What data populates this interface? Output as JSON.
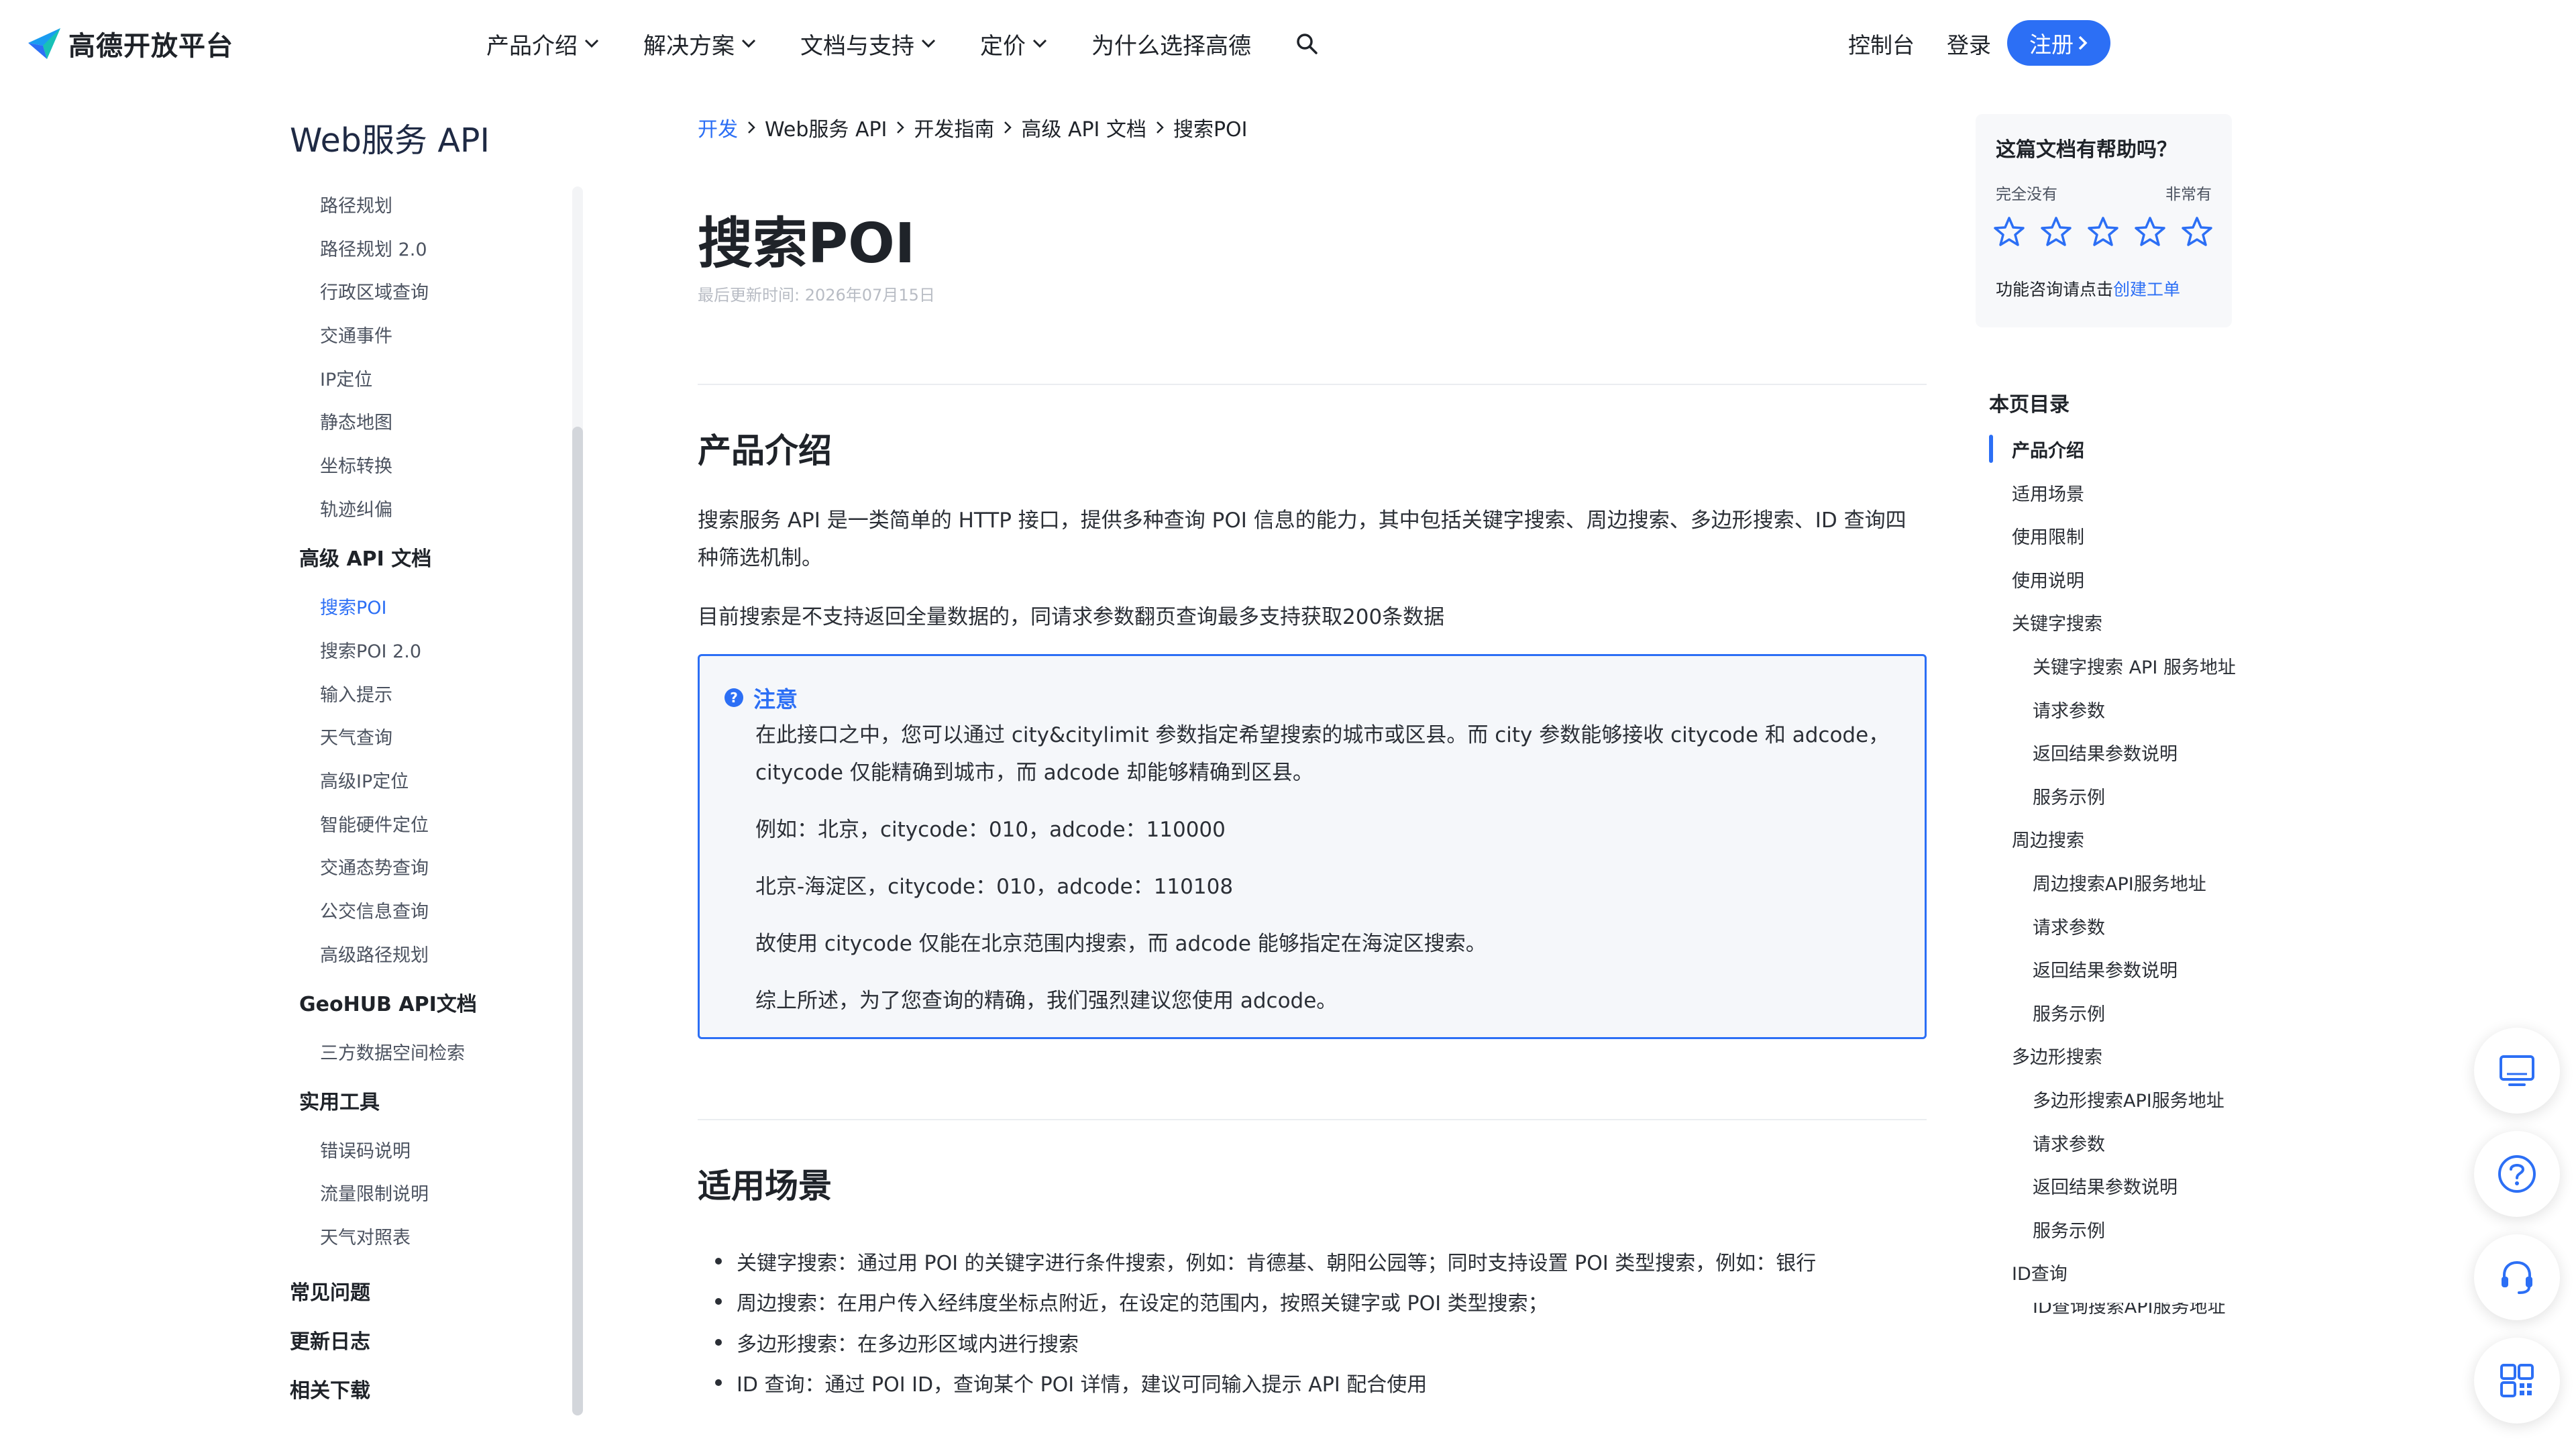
{
  "header": {
    "logo_text": "高德开放平台",
    "nav": [
      {
        "label": "产品介绍",
        "has_dropdown": true
      },
      {
        "label": "解决方案",
        "has_dropdown": true
      },
      {
        "label": "文档与支持",
        "has_dropdown": true
      },
      {
        "label": "定价",
        "has_dropdown": true
      },
      {
        "label": "为什么选择高德",
        "has_dropdown": false
      }
    ],
    "search_icon": "search-icon",
    "console_label": "控制台",
    "login_label": "登录",
    "register_label": "注册"
  },
  "sidebar": {
    "title": "Web服务 API",
    "items": [
      {
        "label": "路径规划",
        "kind": "sub"
      },
      {
        "label": "路径规划 2.0",
        "kind": "sub"
      },
      {
        "label": "行政区域查询",
        "kind": "sub"
      },
      {
        "label": "交通事件",
        "kind": "sub"
      },
      {
        "label": "IP定位",
        "kind": "sub"
      },
      {
        "label": "静态地图",
        "kind": "sub"
      },
      {
        "label": "坐标转换",
        "kind": "sub"
      },
      {
        "label": "轨迹纠偏",
        "kind": "sub"
      },
      {
        "label": "高级 API 文档",
        "kind": "group"
      },
      {
        "label": "搜索POI",
        "kind": "sub",
        "active": true
      },
      {
        "label": "搜索POI 2.0",
        "kind": "sub"
      },
      {
        "label": "输入提示",
        "kind": "sub"
      },
      {
        "label": "天气查询",
        "kind": "sub"
      },
      {
        "label": "高级IP定位",
        "kind": "sub"
      },
      {
        "label": "智能硬件定位",
        "kind": "sub"
      },
      {
        "label": "交通态势查询",
        "kind": "sub"
      },
      {
        "label": "公交信息查询",
        "kind": "sub"
      },
      {
        "label": "高级路径规划",
        "kind": "sub"
      },
      {
        "label": "GeoHUB API文档",
        "kind": "group"
      },
      {
        "label": "三方数据空间检索",
        "kind": "sub"
      },
      {
        "label": "实用工具",
        "kind": "group"
      },
      {
        "label": "错误码说明",
        "kind": "sub"
      },
      {
        "label": "流量限制说明",
        "kind": "sub"
      },
      {
        "label": "天气对照表",
        "kind": "sub"
      },
      {
        "label": "常见问题",
        "kind": "top"
      },
      {
        "label": "更新日志",
        "kind": "top"
      },
      {
        "label": "相关下载",
        "kind": "top"
      }
    ]
  },
  "breadcrumb": [
    "开发",
    "Web服务 API",
    "开发指南",
    "高级 API 文档",
    "搜索POI"
  ],
  "main": {
    "title": "搜索POI",
    "updated": "最后更新时间: 2026年07月15日",
    "section1_title": "产品介绍",
    "intro_p1": "搜索服务 API 是一类简单的 HTTP 接口，提供多种查询 POI 信息的能力，其中包括关键字搜索、周边搜索、多边形搜索、ID 查询四种筛选机制。",
    "intro_p2": "目前搜索是不支持返回全量数据的，同请求参数翻页查询最多支持获取200条数据",
    "notice": {
      "title": "注意",
      "line1": "在此接口之中，您可以通过 city&citylimit 参数指定希望搜索的城市或区县。而 city 参数能够接收 citycode 和 adcode，citycode 仅能精确到城市，而 adcode 却能够精确到区县。",
      "line2": "例如：北京，citycode：010，adcode：110000",
      "line3": "北京-海淀区，citycode：010，adcode：110108",
      "line4": "故使用 citycode 仅能在北京范围内搜索，而 adcode 能够指定在海淀区搜索。",
      "line5": "综上所述，为了您查询的精确，我们强烈建议您使用 adcode。"
    },
    "section2_title": "适用场景",
    "bullets": [
      "关键字搜索：通过用 POI 的关键字进行条件搜索，例如：肯德基、朝阳公园等；同时支持设置 POI 类型搜索，例如：银行",
      "周边搜索：在用户传入经纬度坐标点附近，在设定的范围内，按照关键字或 POI 类型搜索；",
      "多边形搜索：在多边形区域内进行搜索",
      "ID 查询：通过 POI ID，查询某个 POI 详情，建议可同输入提示 API 配合使用"
    ]
  },
  "feedback": {
    "question": "这篇文档有帮助吗？",
    "low": "完全没有",
    "high": "非常有",
    "stars": 5,
    "contact_prefix": "功能咨询请点击",
    "contact_link": "创建工单"
  },
  "toc": {
    "title": "本页目录",
    "items": [
      {
        "label": "产品介绍",
        "level": 1,
        "active": true
      },
      {
        "label": "适用场景",
        "level": 1
      },
      {
        "label": "使用限制",
        "level": 1
      },
      {
        "label": "使用说明",
        "level": 1
      },
      {
        "label": "关键字搜索",
        "level": 1
      },
      {
        "label": "关键字搜索 API 服务地址",
        "level": 2
      },
      {
        "label": "请求参数",
        "level": 2
      },
      {
        "label": "返回结果参数说明",
        "level": 2
      },
      {
        "label": "服务示例",
        "level": 2
      },
      {
        "label": "周边搜索",
        "level": 1
      },
      {
        "label": "周边搜索API服务地址",
        "level": 2
      },
      {
        "label": "请求参数",
        "level": 2
      },
      {
        "label": "返回结果参数说明",
        "level": 2
      },
      {
        "label": "服务示例",
        "level": 2
      },
      {
        "label": "多边形搜索",
        "level": 1
      },
      {
        "label": "多边形搜索API服务地址",
        "level": 2
      },
      {
        "label": "请求参数",
        "level": 2
      },
      {
        "label": "返回结果参数说明",
        "level": 2
      },
      {
        "label": "服务示例",
        "level": 2
      },
      {
        "label": "ID查询",
        "level": 1
      },
      {
        "label": "ID查询搜索API服务地址",
        "level": 2
      }
    ]
  },
  "floating": [
    "monitor-icon",
    "help-icon",
    "headset-icon",
    "qrcode-icon"
  ],
  "colors": {
    "accent": "#2c6ff5",
    "text": "#1f2329",
    "muted": "#b8bcc4"
  }
}
